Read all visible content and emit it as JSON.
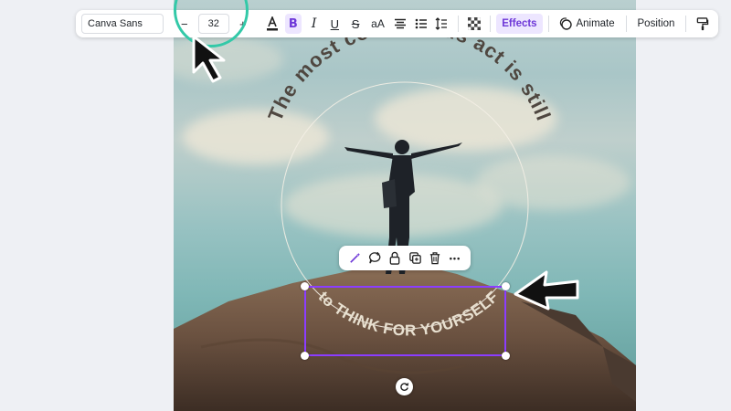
{
  "toolbar": {
    "font_name": "Canva Sans",
    "decrease_label": "−",
    "font_size": "32",
    "increase_label": "+",
    "case_label": "aA",
    "effects_label": "Effects",
    "animate_label": "Animate",
    "position_label": "Position"
  },
  "design": {
    "curved_top_text": "The most courageous act is still",
    "curved_bottom_text": "to THINK FOR YOURSELF"
  },
  "context_menu": {
    "more_label": "•••"
  },
  "colors": {
    "accent": "#8b3dff",
    "effects_bg": "#ede6ff",
    "highlight": "#33c9a8",
    "canvas_bg": "#eef0f4"
  }
}
